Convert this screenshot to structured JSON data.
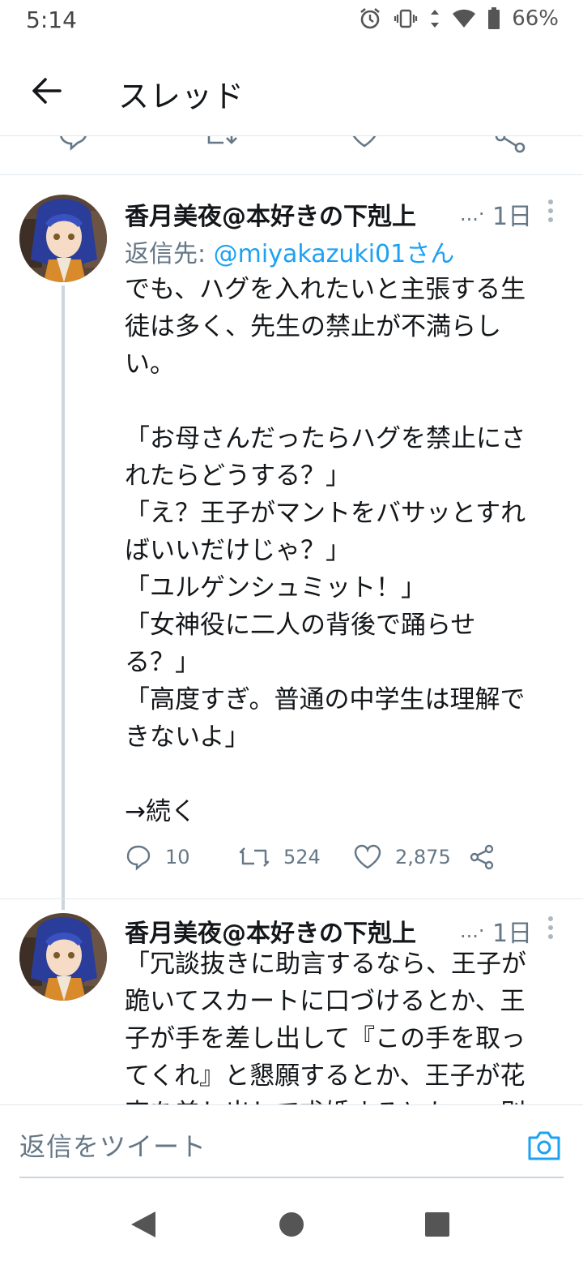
{
  "status_bar": {
    "time": "5:14",
    "battery": "66%",
    "icons": [
      "alarm-icon",
      "vibrate-icon",
      "data-arrows-icon",
      "wifi-icon",
      "battery-icon"
    ]
  },
  "header": {
    "back_icon": "arrow-left-icon",
    "title": "スレッド"
  },
  "previous_tweet_actions": [
    "reply-icon",
    "retweet-icon",
    "like-icon",
    "share-icon"
  ],
  "tweets": [
    {
      "name": "香月美夜@本好きの下剋上",
      "ellipsis": "...·",
      "time": "1日",
      "reply_prefix": "返信先: ",
      "reply_handle": "@miyakazuki01さん",
      "lines": [
        "でも、ハグを入れたいと主張する生",
        "徒は多く、先生の禁止が不満らし",
        "い。",
        "",
        "「お母さんだったらハグを禁止にさ",
        "れたらどうする？」",
        "「え？王子がマントをバサッとすれ",
        "ばいいだけじゃ？」",
        "「ユルゲンシュミット！」",
        "「女神役に二人の背後で踊らせ",
        "る？」",
        "「高度すぎ。普通の中学生は理解で",
        "きないよ」",
        "",
        "→続く"
      ],
      "reply_count": "10",
      "retweet_count": "524",
      "like_count": "2,875"
    },
    {
      "name": "香月美夜@本好きの下剋上",
      "ellipsis": "...·",
      "time": "1日",
      "lines": [
        "「冗談抜きに助言するなら、王子が",
        "跪いてスカートに口づけるとか、王",
        "子が手を差し出して『この手を取っ",
        "てくれ』と懇願するとか、王子が花",
        "束を差し出して求婚するとか……別"
      ]
    }
  ],
  "composer": {
    "placeholder": "返信をツイート",
    "camera_icon": "camera-icon"
  },
  "nav_bar": [
    "back-triangle-icon",
    "home-circle-icon",
    "recents-square-icon"
  ],
  "colors": {
    "accent": "#1da1f2",
    "text": "#14171a",
    "secondary": "#657786",
    "divider": "#e1e8ed",
    "thread_line": "#ccd6dd"
  }
}
